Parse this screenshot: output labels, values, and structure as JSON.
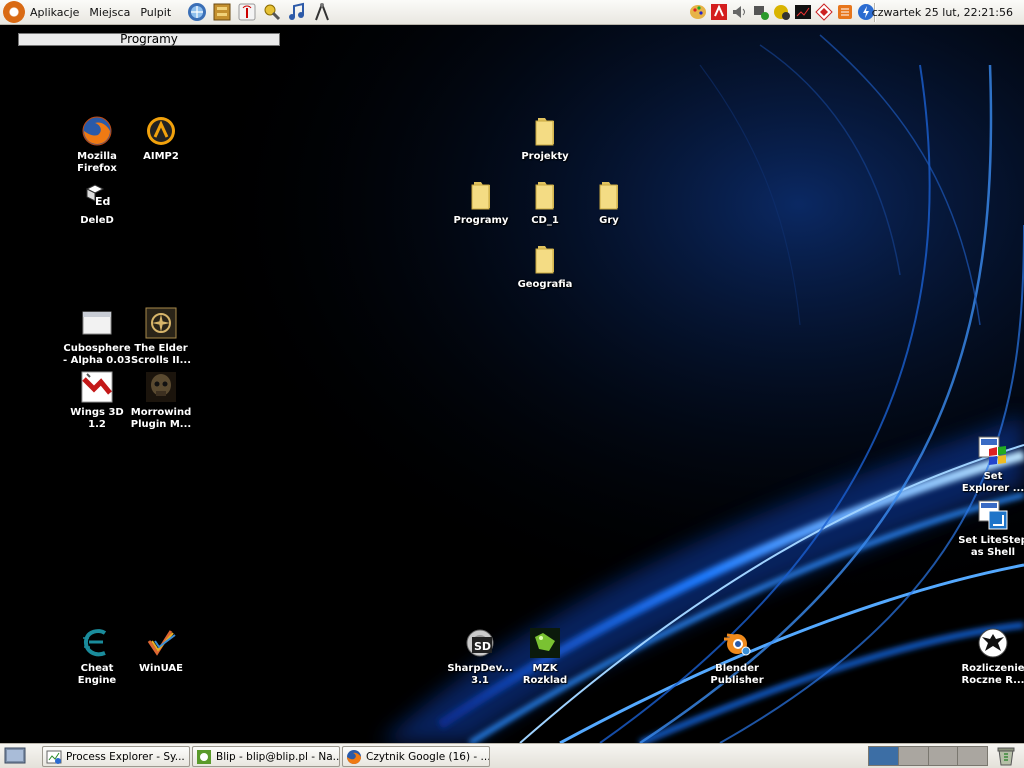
{
  "top_panel": {
    "menus": [
      "Aplikacje",
      "Miejsca",
      "Pulpit"
    ],
    "launchers": [
      "web-browser-icon",
      "file-cabinet-icon",
      "network-antenna-icon",
      "key-tools-icon",
      "music-note-icon",
      "compass-icon"
    ],
    "tray": [
      "paint-palette-icon",
      "red-app-icon",
      "volume-icon",
      "network-status-icon",
      "updates-icon",
      "terminal-monitor-icon",
      "diamond-app-icon",
      "shield-icon",
      "power-icon"
    ],
    "clock": "czwartek 25 lut, 22:21:56"
  },
  "desktop": {
    "programs_bar": "Programy",
    "icons": [
      {
        "id": "firefox",
        "label": "Mozilla\nFirefox",
        "icon": "firefox-icon"
      },
      {
        "id": "aimp2",
        "label": "AIMP2",
        "icon": "aimp-icon"
      },
      {
        "id": "deled",
        "label": "DeleD",
        "icon": "deled-icon"
      },
      {
        "id": "cubosphere",
        "label": "Cubosphere\n- Alpha 0.03",
        "icon": "window-icon"
      },
      {
        "id": "elder-scrolls",
        "label": "The Elder\nScrolls II...",
        "icon": "elder-scrolls-icon"
      },
      {
        "id": "wings3d",
        "label": "Wings 3D\n1.2",
        "icon": "wings3d-icon"
      },
      {
        "id": "morrowind-plugin",
        "label": "Morrowind\nPlugin M...",
        "icon": "skull-icon"
      },
      {
        "id": "projekty",
        "label": "Projekty",
        "icon": "folder-icon"
      },
      {
        "id": "programy",
        "label": "Programy",
        "icon": "folder-icon"
      },
      {
        "id": "cd1",
        "label": "CD_1",
        "icon": "folder-icon"
      },
      {
        "id": "gry",
        "label": "Gry",
        "icon": "folder-icon"
      },
      {
        "id": "geografia",
        "label": "Geografia",
        "icon": "folder-icon"
      },
      {
        "id": "set-explorer",
        "label": "Set\nExplorer ...",
        "icon": "windows-flag-icon"
      },
      {
        "id": "set-litestep",
        "label": "Set LiteStep\nas Shell",
        "icon": "litestep-icon"
      },
      {
        "id": "cheat-engine",
        "label": "Cheat\nEngine",
        "icon": "cheat-engine-icon"
      },
      {
        "id": "winuae",
        "label": "WinUAE",
        "icon": "winuae-icon"
      },
      {
        "id": "sharpdevelop",
        "label": "SharpDev...\n3.1",
        "icon": "sharpdevelop-icon"
      },
      {
        "id": "mzk-rozklad",
        "label": "MZK\nRozklad",
        "icon": "mzk-icon"
      },
      {
        "id": "blender-publisher",
        "label": "Blender\nPublisher",
        "icon": "blender-icon"
      },
      {
        "id": "rozliczenie",
        "label": "Rozliczenie\nRoczne R...",
        "icon": "eagle-icon"
      }
    ]
  },
  "bottom_panel": {
    "tasks": [
      {
        "label": "Process Explorer - Sy...",
        "icon": "process-explorer-icon"
      },
      {
        "label": "Blip - blip@blip.pl - Na...",
        "icon": "blip-icon"
      },
      {
        "label": "Czytnik Google (16) - ...",
        "icon": "firefox-icon"
      }
    ],
    "workspaces": 4,
    "active_workspace": 1
  }
}
